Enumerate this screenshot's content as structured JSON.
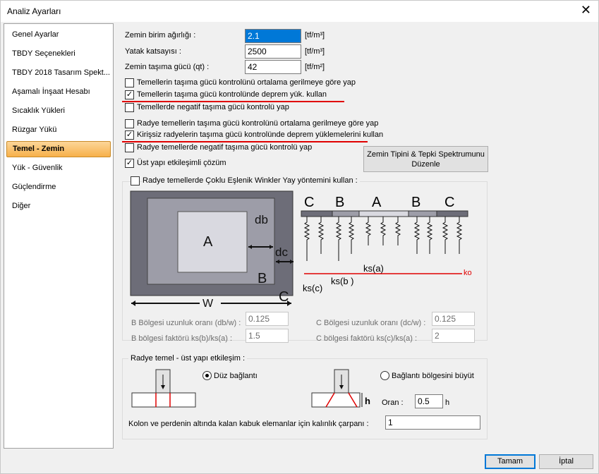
{
  "window": {
    "title": "Analiz Ayarları",
    "close_glyph": "✕"
  },
  "sidebar": {
    "items": [
      {
        "label": "Genel Ayarlar"
      },
      {
        "label": "TBDY Seçenekleri"
      },
      {
        "label": "TBDY 2018 Tasarım Spekt..."
      },
      {
        "label": "Aşamalı İnşaat Hesabı"
      },
      {
        "label": "Sıcaklık Yükleri"
      },
      {
        "label": "Rüzgar Yükü"
      },
      {
        "label": "Temel - Zemin"
      },
      {
        "label": "Yük - Güvenlik"
      },
      {
        "label": "Güçlendirme"
      },
      {
        "label": "Diğer"
      }
    ],
    "active_index": 6
  },
  "soil": {
    "unit_weight_label": "Zemin birim ağırlığı :",
    "unit_weight_value": "2.1",
    "unit_weight_unit": "[tf/m³]",
    "subgrade_label": "Yatak katsayısı :",
    "subgrade_value": "2500",
    "subgrade_unit": "[tf/m³]",
    "bearing_label": "Zemin taşıma gücü (qt) :",
    "bearing_value": "42",
    "bearing_unit": "[tf/m²]"
  },
  "checks": {
    "c1": "Temellerin taşıma gücü kontrolünü ortalama gerilmeye göre yap",
    "c2": "Temellerin taşıma gücü kontrolünde deprem yük. kullan",
    "c3": "Temellerde negatif taşıma gücü kontrolü yap",
    "c4": "Radye temellerin taşıma gücü kontrolünü ortalama gerilmeye göre yap",
    "c5": "Kirişsiz radyelerin taşıma gücü kontrolünde deprem yüklemelerini kullan",
    "c6": "Radye temellerde negatif taşıma gücü kontrolü yap",
    "c7": "Üst yapı etkileşimli çözüm",
    "check_glyph": "✓"
  },
  "spectrum_button": {
    "line1": "Zemin Tipini  & Tepki Spektrumunu",
    "line2": "Düzenle"
  },
  "winkler": {
    "label": "Radye temellerde Çoklu Eşlenik Winkler Yay yöntemini kullan :",
    "diagram": {
      "zone_a": "A",
      "zone_b": "B",
      "zone_c": "C",
      "db": "db",
      "dc": "dc",
      "w": "W",
      "ks_a": "ks(a)",
      "ks_b": "ks(b )",
      "ks_c": "ks(c)",
      "ko": "ko"
    },
    "b_len_label": "B Bölgesi uzunluk oranı (db/w) :",
    "b_len_value": "0.125",
    "c_len_label": "C Bölgesi uzunluk oranı (dc/w) :",
    "c_len_value": "0.125",
    "b_fac_label": "B bölgesi faktörü ks(b)/ks(a) :",
    "b_fac_value": "1.5",
    "c_fac_label": "C bölgesi faktörü ks(c)/ks(a) :",
    "c_fac_value": "2"
  },
  "interaction": {
    "group_label": "Radye temel - üst yapı etkileşim :",
    "rigid_label": "Düz bağlantı",
    "grow_label": "Bağlantı bölgesini büyüt",
    "h_label": "h",
    "ratio_label": "Oran :",
    "ratio_value": "0.5",
    "ratio_unit": "h",
    "thickness_label": "Kolon ve perdenin altında kalan kabuk elemanlar için kalınlık çarpanı :",
    "thickness_value": "1"
  },
  "footer": {
    "ok": "Tamam",
    "cancel": "İptal"
  },
  "colors": {
    "accent_red": "#e00000",
    "selection_blue": "#0078d7",
    "active_item": "#f7b04a"
  }
}
